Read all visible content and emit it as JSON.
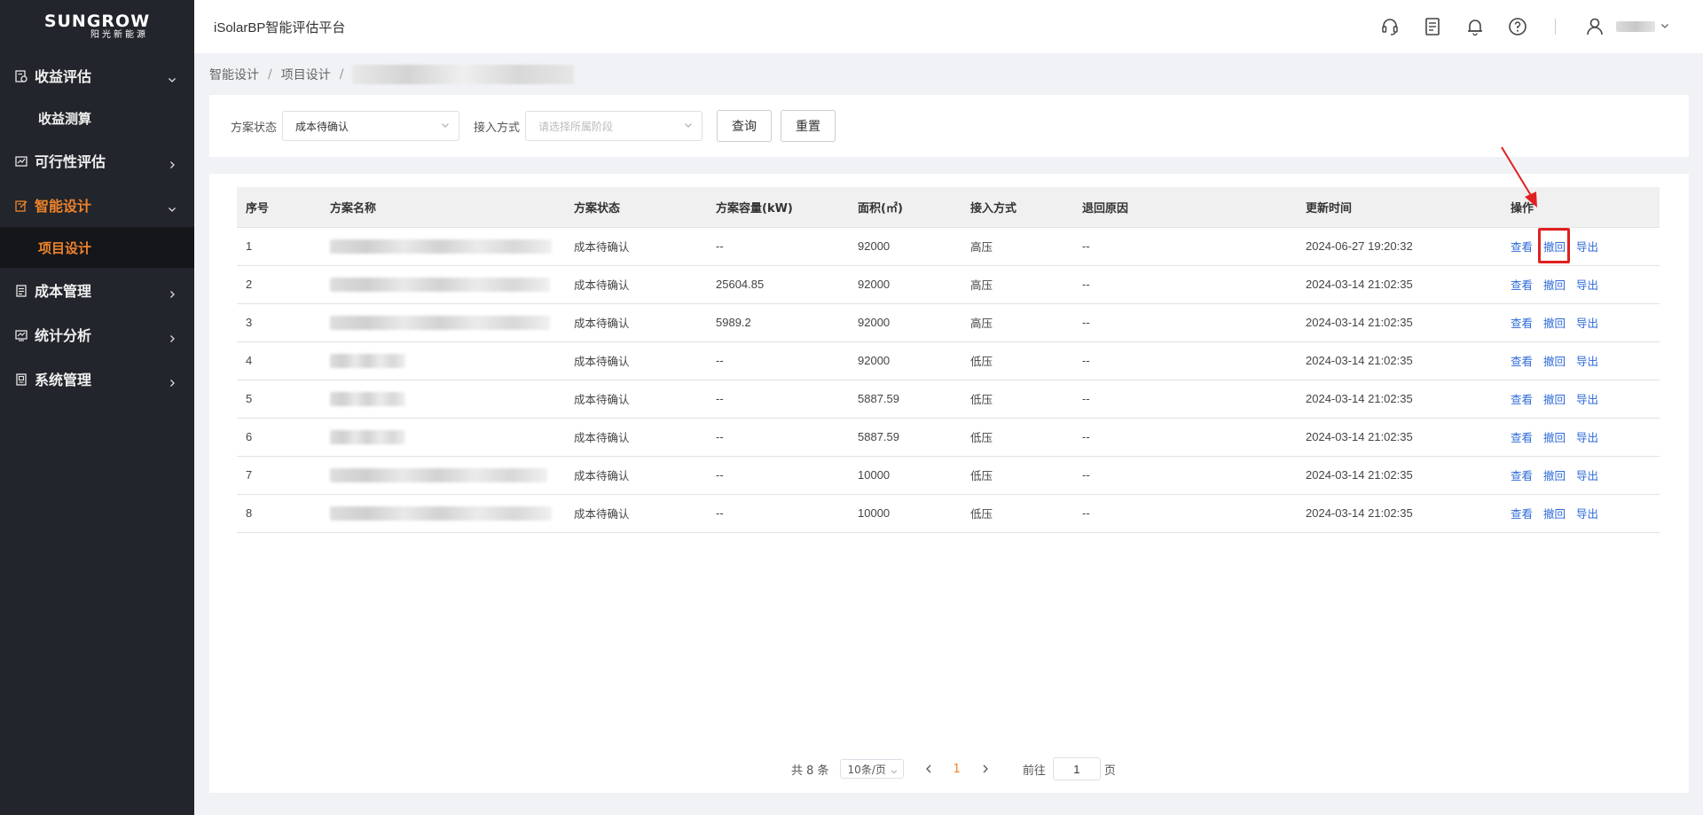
{
  "brand": {
    "logo_main": "SUNGROW",
    "logo_sub": "阳光新能源"
  },
  "header": {
    "title": "iSolarBP智能评估平台"
  },
  "sidebar": {
    "items": [
      {
        "label": "收益评估",
        "chevron": "down"
      },
      {
        "label": "收益测算",
        "sub": true
      },
      {
        "label": "可行性评估",
        "chevron": "right"
      },
      {
        "label": "智能设计",
        "chevron": "down",
        "active": true
      },
      {
        "label": "项目设计",
        "sub": true,
        "active": true
      },
      {
        "label": "成本管理",
        "chevron": "right"
      },
      {
        "label": "统计分析",
        "chevron": "right"
      },
      {
        "label": "系统管理",
        "chevron": "right"
      }
    ]
  },
  "breadcrumb": {
    "items": [
      "智能设计",
      "项目设计"
    ]
  },
  "filters": {
    "status_label": "方案状态",
    "status_value": "成本待确认",
    "access_label": "接入方式",
    "access_placeholder": "请选择所属阶段",
    "query_button": "查询",
    "reset_button": "重置"
  },
  "table": {
    "columns": [
      "序号",
      "方案名称",
      "方案状态",
      "方案容量(kW)",
      "面积(㎡)",
      "接入方式",
      "退回原因",
      "更新时间",
      "操作"
    ],
    "actions": [
      "查看",
      "撤回",
      "导出"
    ],
    "rows": [
      {
        "index": "1",
        "status": "成本待确认",
        "capacity": "--",
        "area": "92000",
        "access": "高压",
        "reason": "--",
        "updated": "2024-06-27 19:20:32"
      },
      {
        "index": "2",
        "status": "成本待确认",
        "capacity": "25604.85",
        "area": "92000",
        "access": "高压",
        "reason": "--",
        "updated": "2024-03-14 21:02:35"
      },
      {
        "index": "3",
        "status": "成本待确认",
        "capacity": "5989.2",
        "area": "92000",
        "access": "高压",
        "reason": "--",
        "updated": "2024-03-14 21:02:35"
      },
      {
        "index": "4",
        "status": "成本待确认",
        "capacity": "--",
        "area": "92000",
        "access": "低压",
        "reason": "--",
        "updated": "2024-03-14 21:02:35"
      },
      {
        "index": "5",
        "status": "成本待确认",
        "capacity": "--",
        "area": "5887.59",
        "access": "低压",
        "reason": "--",
        "updated": "2024-03-14 21:02:35"
      },
      {
        "index": "6",
        "status": "成本待确认",
        "capacity": "--",
        "area": "5887.59",
        "access": "低压",
        "reason": "--",
        "updated": "2024-03-14 21:02:35"
      },
      {
        "index": "7",
        "status": "成本待确认",
        "capacity": "--",
        "area": "10000",
        "access": "低压",
        "reason": "--",
        "updated": "2024-03-14 21:02:35"
      },
      {
        "index": "8",
        "status": "成本待确认",
        "capacity": "--",
        "area": "10000",
        "access": "低压",
        "reason": "--",
        "updated": "2024-03-14 21:02:35"
      }
    ]
  },
  "pagination": {
    "total_text": "共 8 条",
    "page_size": "10条/页",
    "current_page": "1",
    "goto_label": "前往",
    "goto_value": "1",
    "page_suffix": "页"
  },
  "colors": {
    "accent": "#f0832a",
    "link": "#2f6bd8",
    "highlight": "#e02020",
    "sidebar_bg": "#22252b"
  }
}
